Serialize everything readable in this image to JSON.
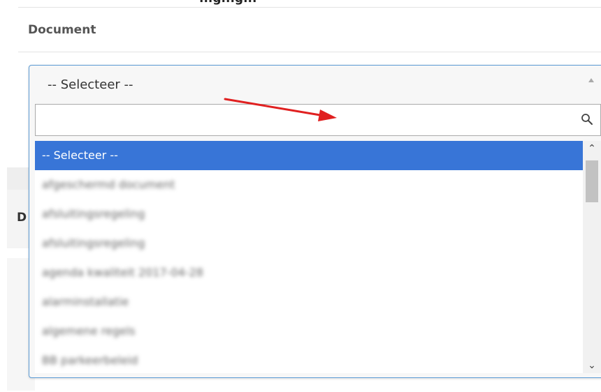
{
  "page": {
    "top_heading": "...g...g...",
    "section_label": "Document",
    "background_letter": "D"
  },
  "select": {
    "current_value": "-- Selecteer --",
    "search": {
      "value": "",
      "placeholder": ""
    },
    "options": [
      {
        "label": "-- Selecteer --",
        "highlighted": true,
        "blurred": false
      },
      {
        "label": "afgeschermd document",
        "highlighted": false,
        "blurred": true
      },
      {
        "label": "afsluitingsregeling",
        "highlighted": false,
        "blurred": true
      },
      {
        "label": "afsluitingsregeling",
        "highlighted": false,
        "blurred": true
      },
      {
        "label": "agenda kwaliteit 2017-04-28",
        "highlighted": false,
        "blurred": true
      },
      {
        "label": "alarminstallatie",
        "highlighted": false,
        "blurred": true
      },
      {
        "label": "algemene regels",
        "highlighted": false,
        "blurred": true
      },
      {
        "label": "BB parkeerbeleid",
        "highlighted": false,
        "blurred": true
      }
    ]
  },
  "colors": {
    "highlight": "#3875d7",
    "focus_border": "#5b9bd5",
    "annotation_arrow": "#e02020"
  },
  "icons": {
    "search": "search-icon",
    "scroll_up": "chevron-up-icon",
    "scroll_down": "chevron-down-icon",
    "caret": "caret-up-icon"
  }
}
